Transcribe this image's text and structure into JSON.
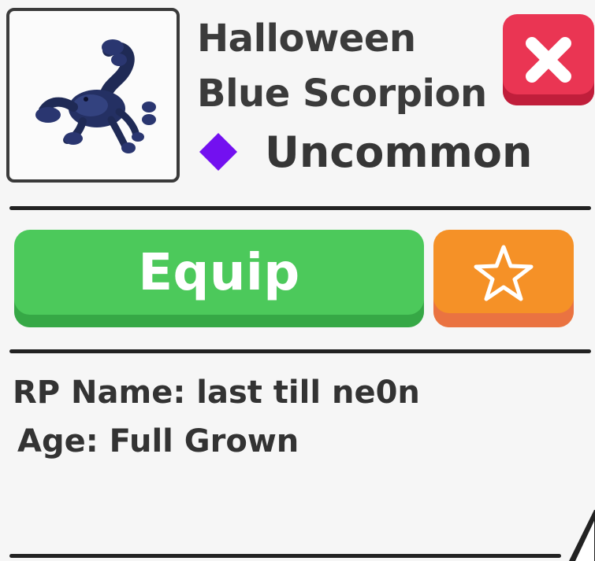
{
  "pet": {
    "name_line1": "Halloween",
    "name_line2": "Blue Scorpion",
    "rarity": "Uncommon",
    "rarity_color": "#7310f0",
    "thumbnail_icon": "blue-scorpion-icon"
  },
  "actions": {
    "equip_label": "Equip",
    "equip_color": "#4cc95b",
    "favorite_icon": "star-outline-icon",
    "favorite_color": "#f59127",
    "close_icon": "close-x-icon",
    "close_color": "#ea3553"
  },
  "details": {
    "rp_name_line": "RP Name: last till ne0n",
    "age_line": "Age: Full Grown"
  }
}
